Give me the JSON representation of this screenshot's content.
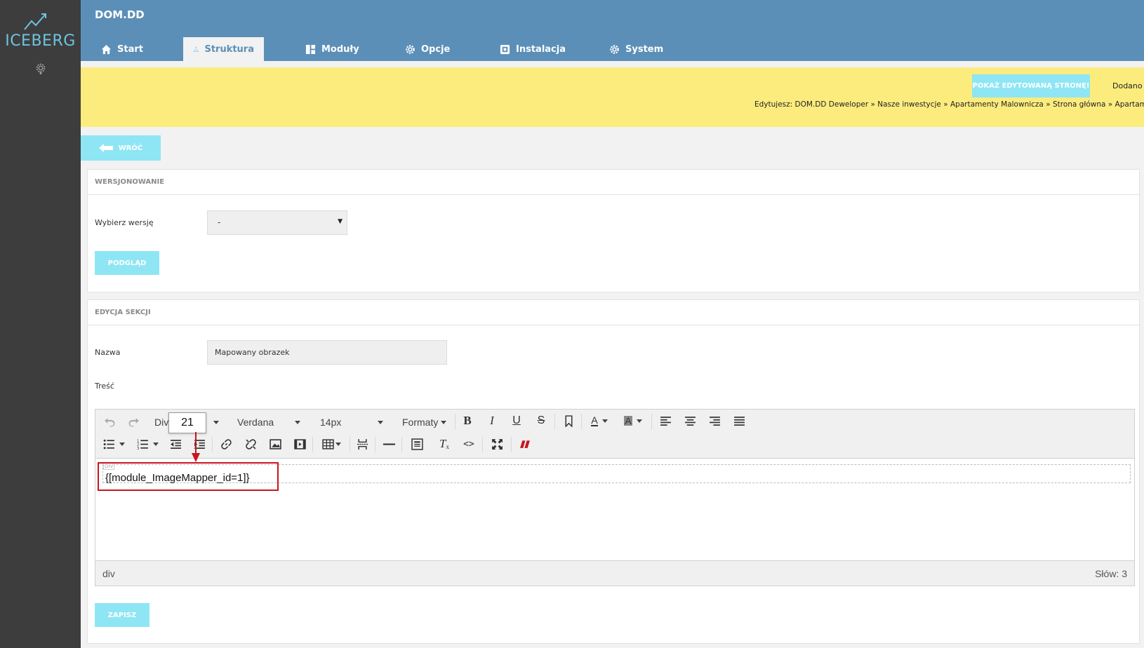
{
  "brand": {
    "name": "ICEBERG"
  },
  "header": {
    "site_title": "DOM.DD"
  },
  "tabs": [
    {
      "label": "Start",
      "icon": "home-icon"
    },
    {
      "label": "Struktura",
      "icon": "structure-icon",
      "active": true
    },
    {
      "label": "Moduły",
      "icon": "modules-icon"
    },
    {
      "label": "Opcje",
      "icon": "gear-icon"
    },
    {
      "label": "Instalacja",
      "icon": "install-icon"
    },
    {
      "label": "System",
      "icon": "gear-icon"
    }
  ],
  "notice": {
    "show_page_button": "POKAŻ EDYTOWANĄ STRONĘ!",
    "added_text": "Dodano :",
    "breadcrumb": "Edytujesz: DOM.DD Deweloper » Nasze inwestycje » Apartamenty Malownicza » Strona główna » Apartamenty M"
  },
  "back_button": "WRÓĆ",
  "versioning": {
    "title": "WERSJONOWANIE",
    "select_label": "Wybierz wersję",
    "selected_value": "-",
    "preview_button": "PODGLĄD"
  },
  "section_edit": {
    "title": "EDYCJA SEKCJI",
    "name_label": "Nazwa",
    "name_value": "Mapowany obrazek",
    "content_label": "Treść",
    "save_button": "ZAPISZ"
  },
  "editor": {
    "block_format": "Div",
    "font_family": "Verdana",
    "font_size": "14px",
    "formats": "Formaty",
    "tooltip_value": "21",
    "div_tag": "DIV",
    "content": "{[module_ImageMapper_id=1]}",
    "path": "div",
    "word_count": "Słów: 3"
  },
  "colors": {
    "header_bg": "#5b8fb8",
    "sidebar_bg": "#3d3d3d",
    "notice_bg": "#fcec7e",
    "button_bg": "#8ee6f5",
    "highlight": "#c9151e"
  }
}
